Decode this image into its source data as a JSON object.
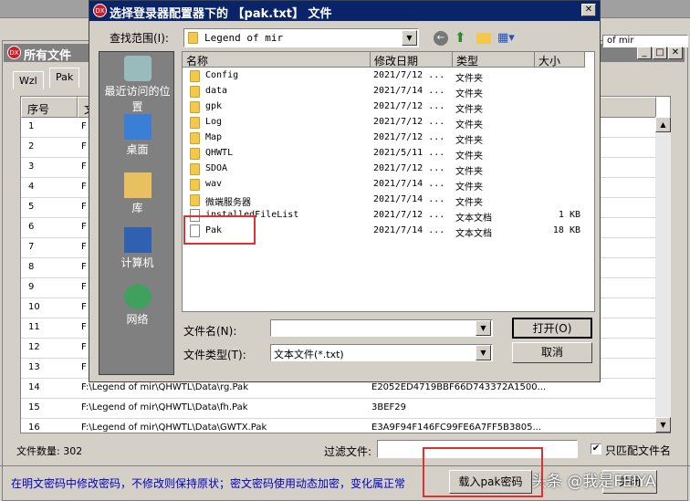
{
  "main": {
    "title": "所有文件",
    "path_fragment": "of mir",
    "tabs": [
      "Wzl",
      "Pak"
    ],
    "columns": [
      "序号",
      "文"
    ],
    "rows": [
      {
        "n": "1",
        "path": "F"
      },
      {
        "n": "2",
        "path": "F"
      },
      {
        "n": "3",
        "path": "F"
      },
      {
        "n": "4",
        "path": "F"
      },
      {
        "n": "5",
        "path": "F"
      },
      {
        "n": "6",
        "path": "F"
      },
      {
        "n": "7",
        "path": "F"
      },
      {
        "n": "8",
        "path": "F"
      },
      {
        "n": "9",
        "path": "F"
      },
      {
        "n": "10",
        "path": "F"
      },
      {
        "n": "11",
        "path": "F"
      },
      {
        "n": "12",
        "path": "F"
      },
      {
        "n": "13",
        "path": "F"
      },
      {
        "n": "14",
        "path": "F:\\Legend of mir\\QHWTL\\Data\\rg.Pak",
        "key": "E2052ED4719BBF66D743372A1500..."
      },
      {
        "n": "15",
        "path": "F:\\Legend of mir\\QHWTL\\Data\\fh.Pak",
        "key": "3BEF29"
      },
      {
        "n": "16",
        "path": "F:\\Legend of mir\\QHWTL\\Data\\GWTX.Pak",
        "key": "E3A9F94F146FC99FE6A7FF5B3805..."
      }
    ],
    "file_count_label": "文件数量: 302",
    "filter_label": "过滤文件:",
    "filter_value": "",
    "match_checkbox_label": "只匹配文件名",
    "match_checked": true,
    "hint": "在明文密码中修改密码，不修改则保持原状；密文密码使用动态加密，变化属正常",
    "load_button": "载入pak密码",
    "close_button": "关闭",
    "watermark": "头条 @我是FEIYA"
  },
  "dialog": {
    "title": "选择登录器配置器下的 【pak.txt】 文件",
    "look_in_label": "查找范围(I):",
    "look_in_value": "Legend of mir",
    "places": [
      "最近访问的位置",
      "桌面",
      "库",
      "计算机",
      "网络"
    ],
    "columns": [
      "名称",
      "修改日期",
      "类型",
      "大小"
    ],
    "files": [
      {
        "name": "Config",
        "date": "2021/7/12 ...",
        "type": "文件夹",
        "size": "",
        "kind": "folder"
      },
      {
        "name": "data",
        "date": "2021/7/14 ...",
        "type": "文件夹",
        "size": "",
        "kind": "folder"
      },
      {
        "name": "gpk",
        "date": "2021/7/12 ...",
        "type": "文件夹",
        "size": "",
        "kind": "folder"
      },
      {
        "name": "Log",
        "date": "2021/7/12 ...",
        "type": "文件夹",
        "size": "",
        "kind": "folder"
      },
      {
        "name": "Map",
        "date": "2021/7/12 ...",
        "type": "文件夹",
        "size": "",
        "kind": "folder"
      },
      {
        "name": "QHWTL",
        "date": "2021/5/11 ...",
        "type": "文件夹",
        "size": "",
        "kind": "folder"
      },
      {
        "name": "SDOA",
        "date": "2021/7/12 ...",
        "type": "文件夹",
        "size": "",
        "kind": "folder"
      },
      {
        "name": "wav",
        "date": "2021/7/14 ...",
        "type": "文件夹",
        "size": "",
        "kind": "folder"
      },
      {
        "name": "微端服务器",
        "date": "2021/7/14 ...",
        "type": "文件夹",
        "size": "",
        "kind": "folder"
      },
      {
        "name": "installedFileList",
        "date": "2021/7/12 ...",
        "type": "文本文档",
        "size": "1 KB",
        "kind": "doc"
      },
      {
        "name": "Pak",
        "date": "2021/7/14 ...",
        "type": "文本文档",
        "size": "18 KB",
        "kind": "doc"
      }
    ],
    "filename_label": "文件名(N):",
    "filename_value": "",
    "filetype_label": "文件类型(T):",
    "filetype_value": "文本文件(*.txt)",
    "open_button": "打开(O)",
    "cancel_button": "取消"
  }
}
